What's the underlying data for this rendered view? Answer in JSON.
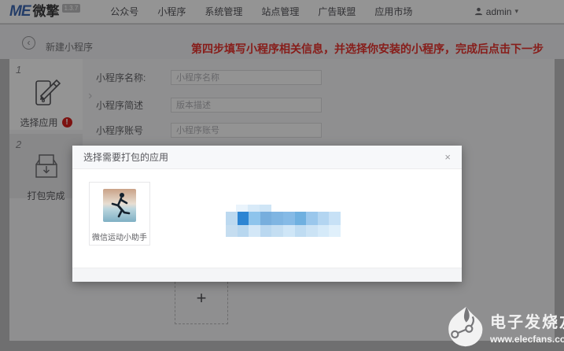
{
  "navbar": {
    "logo": {
      "mark": "ME",
      "name": "微擎",
      "version": "1.3.7"
    },
    "menu": [
      {
        "label": "公众号"
      },
      {
        "label": "小程序"
      },
      {
        "label": "系统管理"
      },
      {
        "label": "站点管理"
      },
      {
        "label": "广告联盟"
      },
      {
        "label": "应用市场"
      }
    ],
    "user": {
      "name": "admin",
      "caret": "▾"
    }
  },
  "toolbar": {
    "back_icon": "‹",
    "title": "新建小程序",
    "instruction": "第四步填写小程序相关信息，并选择你安装的小程序，完成后点击下一步"
  },
  "steps": [
    {
      "number": "1",
      "label": "选择应用",
      "alert": "!"
    },
    {
      "number": "2",
      "label": "打包完成"
    }
  ],
  "step_chevron": "›",
  "form": {
    "fields": [
      {
        "label": "小程序名称:",
        "placeholder": "小程序名称"
      },
      {
        "label": "小程序简述",
        "placeholder": "版本描述"
      },
      {
        "label": "小程序账号",
        "placeholder": "小程序账号"
      }
    ]
  },
  "add_tile": {
    "plus": "+"
  },
  "modal": {
    "title": "选择需要打包的应用",
    "close": "×",
    "apps": [
      {
        "name": "微信运动小助手"
      }
    ],
    "mosaic": {
      "rows": [
        {
          "y": 0,
          "h": 9,
          "x": 13,
          "bw": 15,
          "blocks": [
            "#eaf4fc",
            "#d8eaf8",
            "#cfe5f6"
          ]
        },
        {
          "y": 9,
          "h": 17,
          "x": 0,
          "bw": 14.6,
          "blocks": [
            "#bcd9f0",
            "#2d85d3",
            "#8ec4ec",
            "#77aedd",
            "#7fb5e2",
            "#85bae6",
            "#6fb0e0",
            "#9ac7ec",
            "#b3d5f1",
            "#c7e1f6"
          ]
        },
        {
          "y": 26,
          "h": 15,
          "x": 0,
          "bw": 14.6,
          "blocks": [
            "#c5ddf0",
            "#b8d7ef",
            "#d3e7f7",
            "#bad8f0",
            "#c4def2",
            "#cfe6f7",
            "#bfdcf2",
            "#cbe3f5",
            "#d5eaf9",
            "#e0f0fb"
          ]
        }
      ]
    }
  },
  "watermark": {
    "name": "电子发烧友",
    "url": "www.elecfans.com"
  },
  "colors": {
    "accent_red": "#e8332e",
    "logo_blue": "#3f6ab3",
    "alert_red": "#d8201d",
    "mosaic_highlight": "#2d85d3"
  }
}
